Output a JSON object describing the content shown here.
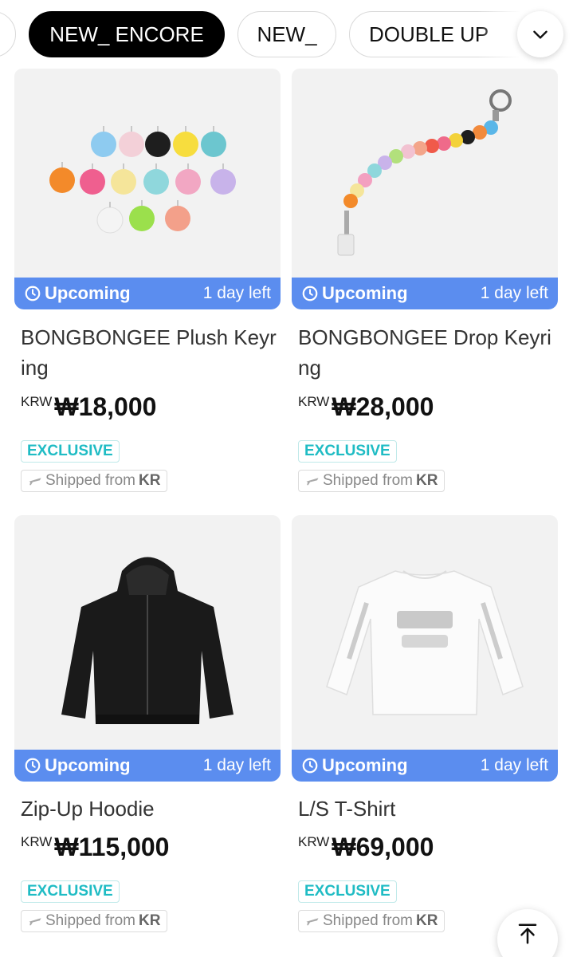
{
  "filters": {
    "chips": [
      "NEW_ ENCORE",
      "NEW_",
      "DOUBLE UP"
    ],
    "active": "NEW_ ENCORE"
  },
  "products": [
    {
      "name": "BONGBONGEE Plush Keyring",
      "status": "Upcoming",
      "days_left": "1 day left",
      "currency": "KRW",
      "price": "₩18,000",
      "badge": "EXCLUSIVE",
      "ship_prefix": "Shipped from",
      "ship_country": "KR"
    },
    {
      "name": "BONGBONGEE Drop Keyring",
      "status": "Upcoming",
      "days_left": "1 day left",
      "currency": "KRW",
      "price": "₩28,000",
      "badge": "EXCLUSIVE",
      "ship_prefix": "Shipped from",
      "ship_country": "KR"
    },
    {
      "name": "Zip-Up Hoodie",
      "status": "Upcoming",
      "days_left": "1 day left",
      "currency": "KRW",
      "price": "₩115,000",
      "badge": "EXCLUSIVE",
      "ship_prefix": "Shipped from",
      "ship_country": "KR"
    },
    {
      "name": "L/S T-Shirt",
      "status": "Upcoming",
      "days_left": "1 day left",
      "currency": "KRW",
      "price": "₩69,000",
      "badge": "EXCLUSIVE",
      "ship_prefix": "Shipped from",
      "ship_country": "KR"
    }
  ],
  "icons": {
    "expand": "chevron-down-icon",
    "status": "clock-icon",
    "shipping": "airplane-icon",
    "scroll_top": "arrow-up-to-line-icon"
  },
  "colors": {
    "upcoming_bar": "#5b8def",
    "exclusive": "#1fbcc4",
    "active_chip": "#000000"
  }
}
